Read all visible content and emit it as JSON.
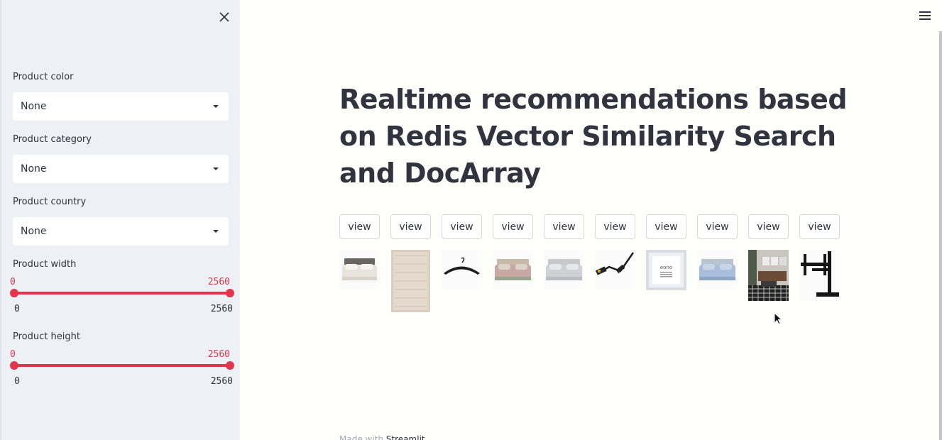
{
  "sidebar": {
    "filters": [
      {
        "label": "Product color",
        "value": "None"
      },
      {
        "label": "Product category",
        "value": "None"
      },
      {
        "label": "Product country",
        "value": "None"
      }
    ],
    "sliders": [
      {
        "label": "Product width",
        "min": "0",
        "max": "2560",
        "selected_low": "0",
        "selected_high": "2560"
      },
      {
        "label": "Product height",
        "min": "0",
        "max": "2560",
        "selected_low": "0",
        "selected_high": "2560"
      }
    ]
  },
  "main": {
    "title": "Realtime recommendations based on Redis Vector Similarity Search and DocArray",
    "view_label": "view",
    "footer_prefix": "Made with",
    "footer_brand": "Streamlit"
  },
  "products": [
    {
      "icon": "bed-white-image"
    },
    {
      "icon": "rug-image"
    },
    {
      "icon": "hanger-image"
    },
    {
      "icon": "bed-pink-image"
    },
    {
      "icon": "bed-grey-image"
    },
    {
      "icon": "usb-cable-image"
    },
    {
      "icon": "picture-frame-image"
    },
    {
      "icon": "bed-blue-image"
    },
    {
      "icon": "living-room-image"
    },
    {
      "icon": "tv-stand-image"
    }
  ],
  "colors": {
    "accent": "#e0354b",
    "sidebar_bg": "#edf0f4",
    "text": "#31333f"
  }
}
